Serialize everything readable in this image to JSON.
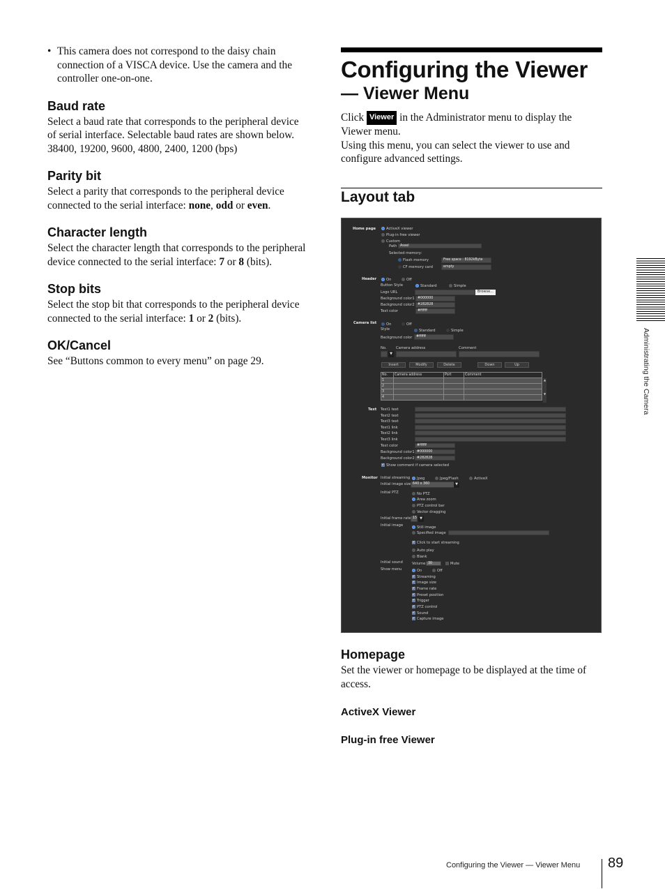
{
  "left": {
    "bullet": "This camera does not correspond to the daisy chain connection of a VISCA device. Use the camera and the controller one-on-one.",
    "sections": [
      {
        "heading": "Baud rate",
        "body": "Select a baud rate that corresponds to the peripheral device of serial interface. Selectable baud rates are shown below.",
        "extra": "38400, 19200, 9600, 4800, 2400, 1200 (bps)"
      },
      {
        "heading": "Parity bit",
        "body_pre": "Select a parity that corresponds to the peripheral device connected to the serial interface: ",
        "opt1": "none",
        "sep1": ", ",
        "opt2": "odd",
        "sep2": " or ",
        "opt3": "even",
        "end": "."
      },
      {
        "heading": "Character length",
        "body_pre": "Select the character length that corresponds to the peripheral device connected to the serial interface: ",
        "opt1": "7",
        "sep1": " or ",
        "opt2": "8",
        "end": " (bits)."
      },
      {
        "heading": "Stop bits",
        "body_pre": "Select the stop bit that corresponds to the peripheral device connected to the serial interface: ",
        "opt1": "1",
        "sep1": " or ",
        "opt2": "2",
        "end": " (bits)."
      },
      {
        "heading": "OK/Cancel",
        "body": "See “Buttons common to every menu” on page 29."
      }
    ]
  },
  "right": {
    "title": "Configuring the Viewer",
    "subtitle": "— Viewer Menu",
    "intro_pre": "Click ",
    "viewer_button": "Viewer",
    "intro_post": " in the Administrator menu to display the Viewer menu.",
    "intro2": "Using this menu, you can select the viewer to use and configure advanced settings.",
    "layout_heading": "Layout tab",
    "homepage_heading": "Homepage",
    "homepage_body": "Set the viewer or homepage to be displayed at the time of access.",
    "activex_heading": "ActiveX Viewer",
    "pluginfree_heading": "Plug-in free Viewer"
  },
  "screenshot": {
    "home_page": {
      "label": "Home page",
      "options": [
        "ActiveX viewer",
        "Plug-in free viewer",
        "Custom"
      ],
      "selected": "ActiveX viewer",
      "path_label": "Path",
      "path_value": "Assel",
      "selected_memory_label": "Selected memory:",
      "flash_memory": "Flash memory",
      "flash_value": "Free space : 8192kByte",
      "cf_card": "CF memory card",
      "cf_value": "empty"
    },
    "header": {
      "label": "Header",
      "on": "On",
      "off": "Off",
      "button_style_label": "Button Style",
      "standard": "Standard",
      "simple": "Simple",
      "logo_url_label": "Logo URL",
      "browse": "Browse...",
      "bg1_label": "Background color1",
      "bg1": "#000000",
      "bg2_label": "Background color2",
      "bg2": "#282828",
      "text_color_label": "Text color",
      "text_color": "#ffffff"
    },
    "camera_list": {
      "label": "Camera list",
      "on": "On",
      "off": "Off",
      "style_label": "Style",
      "standard": "Standard",
      "simple": "Simple",
      "bg_label": "Background color",
      "bg": "#ffffff",
      "no_label": "No.",
      "address_label": "Camera address",
      "comment_label": "Comment",
      "buttons": {
        "insert": "Insert",
        "modify": "Modify",
        "delete": "Delete",
        "down": "Down",
        "up": "Up"
      },
      "table_headers": [
        "No.",
        "Camera address",
        "Port",
        "Comment"
      ],
      "rows": [
        "1",
        "2",
        "3",
        "4"
      ]
    },
    "text": {
      "label": "Text",
      "fields": [
        "Text1 text",
        "Text2 text",
        "Text3 text",
        "Text1 link",
        "Text2 link",
        "Text3 link"
      ],
      "text_color_label": "Text color",
      "text_color": "#ffffff",
      "bg1_label": "Background color1",
      "bg1": "#000000",
      "bg2_label": "Background color2",
      "bg2": "#282828",
      "show_comment": "Show comment if camera selected"
    },
    "monitor": {
      "label": "Monitor",
      "streaming_label": "Initial streaming",
      "streaming_options": [
        "Jpeg",
        "Jpeg/Flash",
        "ActiveX"
      ],
      "image_size_label": "Initial image size",
      "image_size": "640 x 360",
      "ptz_label": "Initial PTZ",
      "ptz_options": [
        "No PTZ",
        "Area zoom",
        "PTZ control bar",
        "Vector dragging"
      ],
      "frame_rate_label": "Initial frame rate",
      "frame_rate": "15",
      "image_label": "Initial image",
      "image_options": [
        "Still image",
        "Specified image"
      ],
      "click_to_start": "Click to start streaming",
      "auto_play": "Auto play",
      "blank": "Blank",
      "sound_label": "Initial sound",
      "volume_label": "Volume:",
      "volume": "30",
      "mute": "Mute",
      "show_menu_label": "Show menu",
      "on": "On",
      "off": "Off",
      "menu_items": [
        "Streaming",
        "Image size",
        "Frame rate",
        "Preset position",
        "Trigger",
        "PTZ control",
        "Sound",
        "Capture image"
      ]
    }
  },
  "sidebar": {
    "label": "Administrating the Camera"
  },
  "footer": {
    "text": "Configuring the Viewer — Viewer Menu",
    "page": "89"
  }
}
